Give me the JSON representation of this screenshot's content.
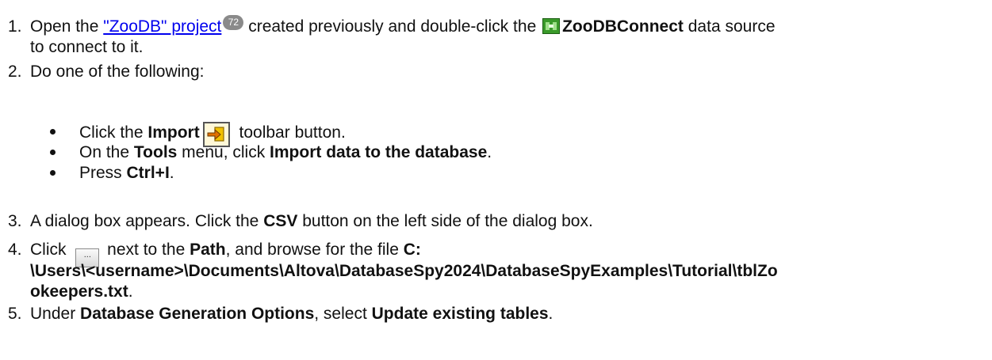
{
  "steps": {
    "s1": {
      "num": "1.",
      "t1": "Open the ",
      "link": "\"ZooDB\" project",
      "badge": "72",
      "t2": " created previously and double-click the ",
      "bold": "ZooDBConnect",
      "t3": " data source",
      "cont": "to connect to it."
    },
    "s2": {
      "num": "2.",
      "text": "Do one of the following:"
    },
    "s3": {
      "num": "3.",
      "t1": "A dialog box appears. Click the ",
      "bold": "CSV",
      "t2": " button on the left side of the dialog box."
    },
    "s4": {
      "num": "4.",
      "t1": "Click ",
      "browse_label": "...",
      "t2": " next to the ",
      "bold1": "Path",
      "t3": ", and browse for the file ",
      "path1": "C:",
      "path2": "\\Users\\<username>\\Documents\\Altova\\DatabaseSpy2024\\DatabaseSpyExamples\\Tutorial\\tblZo",
      "path3": "okeepers.txt",
      "t4": "."
    },
    "s5": {
      "num": "5.",
      "t1": "Under ",
      "bold1": "Database Generation Options",
      "t2": ", select ",
      "bold2": "Update existing tables",
      "t3": "."
    }
  },
  "bullets": {
    "b1": {
      "t1": "Click the ",
      "bold": "Import",
      "t2": " toolbar button."
    },
    "b2": {
      "t1": "On the ",
      "bold1": "Tools",
      "t2": " menu, click ",
      "bold2": "Import data to the database",
      "t3": "."
    },
    "b3": {
      "t1": "Press ",
      "bold": "Ctrl+I",
      "t2": "."
    }
  },
  "icons": {
    "datasource": "datasource-icon",
    "import": "import-icon",
    "browse": "browse-button-icon"
  }
}
